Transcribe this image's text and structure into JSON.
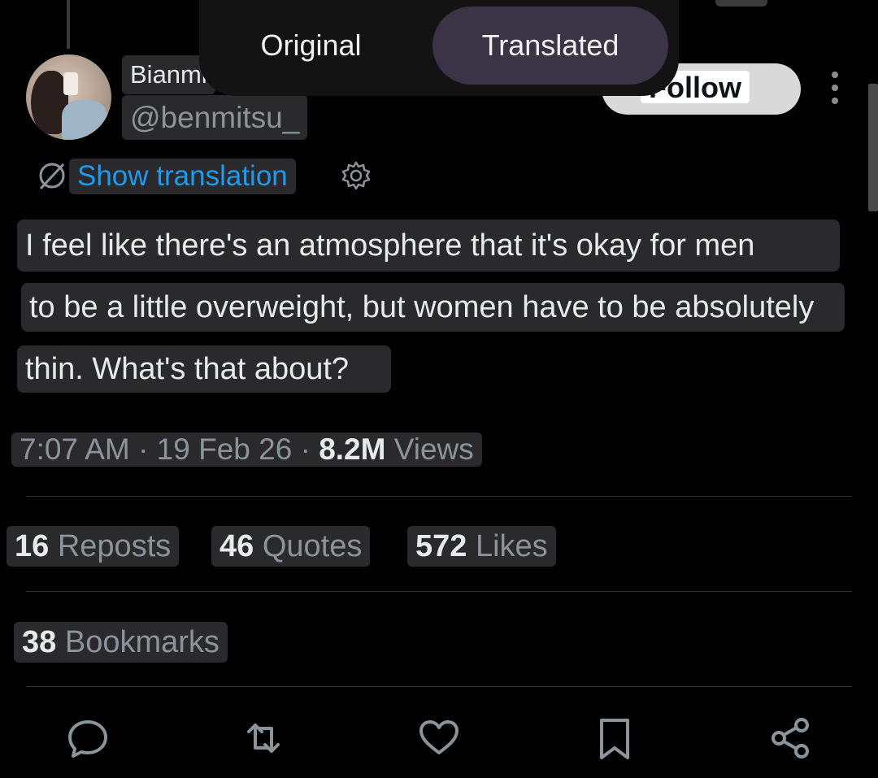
{
  "author": {
    "display_name": "Bianmi",
    "handle": "@benmitsu_"
  },
  "translation_toggle": {
    "original_label": "Original",
    "translated_label": "Translated",
    "selected": "Translated"
  },
  "follow_label": "Follow",
  "show_translation_label": "Show translation",
  "post_lines": [
    "I feel like there's an atmosphere that it's okay for men",
    "to be a little overweight, but women have to be absolutely",
    "thin. What's that about?"
  ],
  "meta": {
    "time": "7:07 AM",
    "sep1": "·",
    "date": "19 Feb 26",
    "sep2": "·",
    "views_count": "8.2M",
    "views_label": "Views"
  },
  "stats": {
    "reposts_count": "16",
    "reposts_label": "Reposts",
    "quotes_count": "46",
    "quotes_label": "Quotes",
    "likes_count": "572",
    "likes_label": "Likes",
    "bookmarks_count": "38",
    "bookmarks_label": "Bookmarks"
  },
  "colors": {
    "background": "#000000",
    "link": "#1d9bf0",
    "muted": "#8b949a",
    "toggle_selected": "#3b3346"
  },
  "icons": {
    "reply": "reply-icon",
    "repost": "repost-icon",
    "like": "like-icon",
    "bookmark": "bookmark-icon",
    "share": "share-icon",
    "translate": "globe-icon",
    "settings": "gear-icon"
  }
}
